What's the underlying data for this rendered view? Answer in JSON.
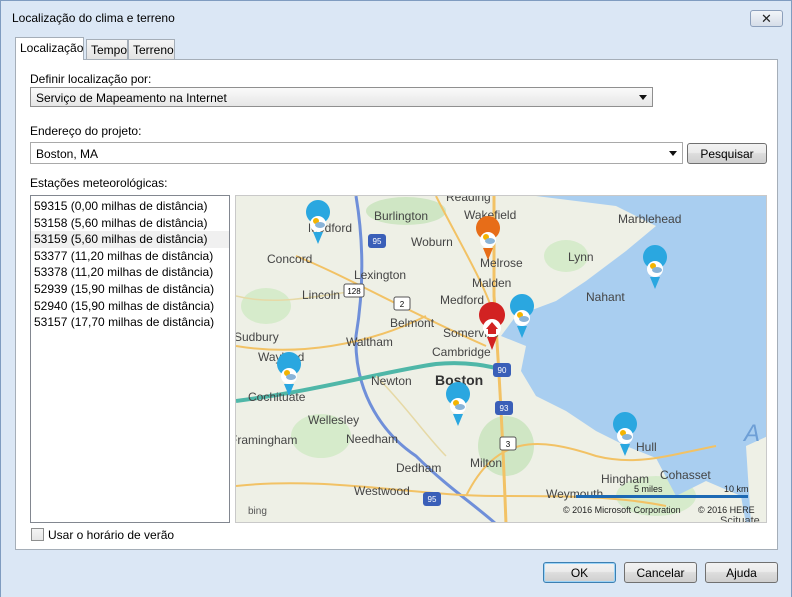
{
  "window": {
    "title": "Localização do clima e terreno"
  },
  "tabs": [
    {
      "label": "Localização"
    },
    {
      "label": "Tempo"
    },
    {
      "label": "Terreno"
    }
  ],
  "location": {
    "define_label": "Definir localização por:",
    "define_value": "Serviço de Mapeamento na Internet",
    "address_label": "Endereço do projeto:",
    "address_value": "Boston, MA",
    "search_button": "Pesquisar",
    "stations_label": "Estações meteorológicas:",
    "stations": [
      "59315 (0,00 milhas de distância)",
      "53158 (5,60 milhas de distância)",
      "53159 (5,60 milhas de distância)",
      "53377 (11,20 milhas de distância)",
      "53378 (11,20 milhas de distância)",
      "52939 (15,90 milhas de distância)",
      "52940 (15,90 milhas de distância)",
      "53157 (17,70 milhas de distância)"
    ],
    "dst_label": "Usar o horário de verão"
  },
  "map": {
    "places": [
      "Medford",
      "Burlington",
      "Wakefield",
      "Marblehead",
      "Reading",
      "Woburn",
      "Concord",
      "Lexington",
      "Melrose",
      "Lynn",
      "Malden",
      "Nahant",
      "Lincoln",
      "Medford",
      "Belmont",
      "Somerville",
      "Waltham",
      "Cambridge",
      "Wayland",
      "Sudbury",
      "Newton",
      "Boston",
      "Cochituate",
      "Wellesley",
      "Needham",
      "Framingham",
      "Dedham",
      "Milton",
      "Hull",
      "Hingham",
      "Cohasset",
      "Westwood",
      "Weymouth",
      "Scituate"
    ],
    "route_numbers": [
      "95",
      "128",
      "2",
      "90",
      "93",
      "3",
      "95"
    ],
    "scale_miles": "5 miles",
    "scale_km": "10 km",
    "copyright_ms": "© 2016 Microsoft Corporation",
    "copyright_here": "© 2016 HERE",
    "bing": "bing",
    "corner_letter": "A"
  },
  "buttons": {
    "ok": "OK",
    "cancel": "Cancelar",
    "help": "Ajuda"
  },
  "colors": {
    "window_bg": "#dbe7f5",
    "water": "#a9cef0",
    "land": "#eef0e6",
    "pin_blue": "#2aa7e0",
    "pin_orange": "#e76d18",
    "pin_red": "#d22222"
  }
}
